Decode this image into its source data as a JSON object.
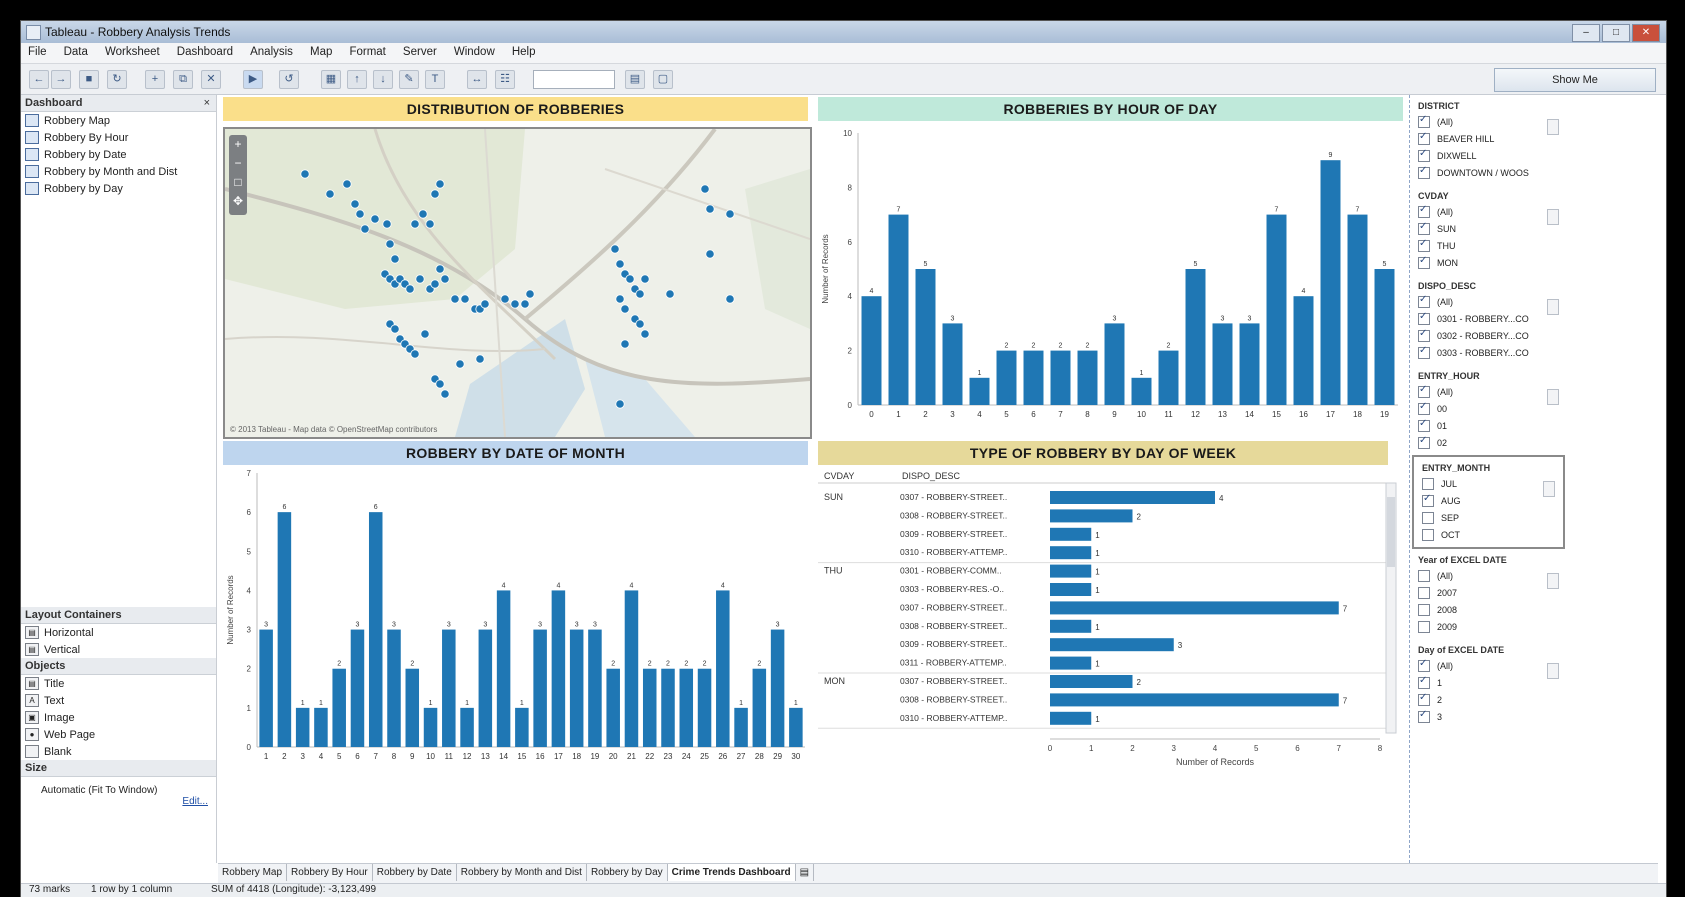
{
  "window": {
    "title": "Tableau - Robbery Analysis Trends",
    "controls": [
      "–",
      "□",
      "✕"
    ]
  },
  "menu": [
    "File",
    "Data",
    "Worksheet",
    "Dashboard",
    "Analysis",
    "Map",
    "Format",
    "Server",
    "Window",
    "Help"
  ],
  "toolbar": {
    "show_me": "Show Me"
  },
  "left_panel": {
    "dashboard_header": "Dashboard",
    "close": "×",
    "sheets": [
      "Robbery Map",
      "Robbery By Hour",
      "Robbery by Date",
      "Robbery by Month and Dist",
      "Robbery by Day"
    ],
    "layout_header": "Layout Containers",
    "layout_items": [
      "Horizontal",
      "Vertical"
    ],
    "objects_header": "Objects",
    "objects": [
      "Title",
      "Text",
      "Image",
      "Web Page",
      "Blank"
    ],
    "size_header": "Size",
    "size_value": "Automatic (Fit To Window)",
    "edit_link": "Edit..."
  },
  "panels": {
    "map_title": "DISTRIBUTION OF ROBBERIES",
    "map_attribution": "© 2013 Tableau - Map data © OpenStreetMap contributors",
    "hour_title": "ROBBERIES BY HOUR OF DAY",
    "date_title": "ROBBERY BY DATE OF MONTH",
    "type_title": "TYPE OF ROBBERY BY DAY OF WEEK"
  },
  "chart_data": [
    {
      "type": "bar",
      "title": "ROBBERIES BY HOUR OF DAY",
      "ylabel": "Number of Records",
      "ylim": [
        0,
        10
      ],
      "yticks": [
        0,
        2,
        4,
        6,
        8,
        10
      ],
      "categories": [
        "0",
        "1",
        "2",
        "3",
        "4",
        "5",
        "6",
        "7",
        "8",
        "9",
        "10",
        "11",
        "12",
        "13",
        "14",
        "15",
        "16",
        "17",
        "18",
        "19"
      ],
      "values": [
        4,
        7,
        5,
        3,
        1,
        2,
        2,
        2,
        2,
        3,
        1,
        2,
        5,
        3,
        3,
        7,
        4,
        9,
        7,
        5
      ]
    },
    {
      "type": "bar",
      "title": "ROBBERY BY DATE OF MONTH",
      "ylabel": "Number of Records",
      "ylim": [
        0,
        7
      ],
      "yticks": [
        0,
        1,
        2,
        3,
        4,
        5,
        6,
        7
      ],
      "categories": [
        "1",
        "2",
        "3",
        "4",
        "5",
        "6",
        "7",
        "8",
        "9",
        "10",
        "11",
        "12",
        "13",
        "14",
        "15",
        "16",
        "17",
        "18",
        "19",
        "20",
        "21",
        "22",
        "23",
        "24",
        "25",
        "26",
        "27",
        "28",
        "29",
        "30"
      ],
      "values": [
        3,
        6,
        1,
        1,
        2,
        3,
        6,
        3,
        2,
        1,
        3,
        1,
        3,
        4,
        1,
        3,
        4,
        3,
        3,
        2,
        4,
        2,
        2,
        2,
        2,
        4,
        1,
        2,
        3,
        1
      ]
    },
    {
      "type": "bar",
      "title": "TYPE OF ROBBERY BY DAY OF WEEK",
      "orientation": "horizontal",
      "columns": [
        "CVDAY",
        "DISPO_DESC"
      ],
      "xlabel": "Number of Records",
      "xlim": [
        0,
        8
      ],
      "xticks": [
        0,
        1,
        2,
        3,
        4,
        5,
        6,
        7,
        8
      ],
      "groups": [
        {
          "day": "SUN",
          "rows": [
            {
              "label": "0307 - ROBBERY-STREET..",
              "value": 4
            },
            {
              "label": "0308 - ROBBERY-STREET..",
              "value": 2
            },
            {
              "label": "0309 - ROBBERY-STREET..",
              "value": 1
            },
            {
              "label": "0310 - ROBBERY-ATTEMP..",
              "value": 1
            }
          ]
        },
        {
          "day": "THU",
          "rows": [
            {
              "label": "0301 - ROBBERY-COMM..",
              "value": 1
            },
            {
              "label": "0303 - ROBBERY-RES.-O..",
              "value": 1
            },
            {
              "label": "0307 - ROBBERY-STREET..",
              "value": 7
            },
            {
              "label": "0308 - ROBBERY-STREET..",
              "value": 1
            },
            {
              "label": "0309 - ROBBERY-STREET..",
              "value": 3
            },
            {
              "label": "0311 - ROBBERY-ATTEMP..",
              "value": 1
            }
          ]
        },
        {
          "day": "MON",
          "rows": [
            {
              "label": "0307 - ROBBERY-STREET..",
              "value": 2
            },
            {
              "label": "0308 - ROBBERY-STREET..",
              "value": 7
            },
            {
              "label": "0310 - ROBBERY-ATTEMP..",
              "value": 1
            }
          ]
        }
      ]
    },
    {
      "type": "scatter",
      "title": "DISTRIBUTION OF ROBBERIES",
      "x": [
        80,
        105,
        122,
        130,
        135,
        140,
        150,
        162,
        165,
        170,
        190,
        198,
        205,
        210,
        215,
        160,
        165,
        170,
        175,
        180,
        185,
        195,
        205,
        210,
        215,
        220,
        230,
        240,
        250,
        255,
        260,
        280,
        290,
        300,
        305,
        165,
        170,
        175,
        180,
        185,
        190,
        200,
        210,
        215,
        220,
        235,
        255,
        390,
        395,
        400,
        405,
        410,
        415,
        420,
        395,
        400,
        480,
        485,
        505,
        485,
        410,
        415,
        420,
        400,
        445,
        395,
        505
      ],
      "y": [
        45,
        65,
        55,
        75,
        85,
        100,
        90,
        95,
        115,
        130,
        95,
        85,
        95,
        65,
        55,
        145,
        150,
        155,
        150,
        155,
        160,
        150,
        160,
        155,
        140,
        150,
        170,
        170,
        180,
        180,
        175,
        170,
        175,
        175,
        165,
        195,
        200,
        210,
        215,
        220,
        225,
        205,
        250,
        255,
        265,
        235,
        230,
        120,
        135,
        145,
        150,
        160,
        165,
        150,
        170,
        180,
        60,
        80,
        85,
        125,
        190,
        195,
        205,
        215,
        165,
        275,
        170
      ]
    }
  ],
  "filters": [
    {
      "name": "DISTRICT",
      "items": [
        {
          "label": "(All)",
          "checked": true
        },
        {
          "label": "BEAVER HILL",
          "checked": true
        },
        {
          "label": "DIXWELL",
          "checked": true
        },
        {
          "label": "DOWNTOWN / WOOS",
          "checked": true
        }
      ]
    },
    {
      "name": "CVDAY",
      "items": [
        {
          "label": "(All)",
          "checked": true
        },
        {
          "label": "SUN",
          "checked": true
        },
        {
          "label": "THU",
          "checked": true
        },
        {
          "label": "MON",
          "checked": true
        }
      ]
    },
    {
      "name": "DISPO_DESC",
      "items": [
        {
          "label": "(All)",
          "checked": true
        },
        {
          "label": "0301 - ROBBERY...CO",
          "checked": true
        },
        {
          "label": "0302 - ROBBERY...CO",
          "checked": true
        },
        {
          "label": "0303 - ROBBERY...CO",
          "checked": true
        }
      ]
    },
    {
      "name": "ENTRY_HOUR",
      "items": [
        {
          "label": "(All)",
          "checked": true
        },
        {
          "label": "00",
          "checked": true
        },
        {
          "label": "01",
          "checked": true
        },
        {
          "label": "02",
          "checked": true
        }
      ]
    },
    {
      "name": "ENTRY_MONTH",
      "items": [
        {
          "label": "JUL",
          "checked": false
        },
        {
          "label": "AUG",
          "checked": true
        },
        {
          "label": "SEP",
          "checked": false
        },
        {
          "label": "OCT",
          "checked": false
        }
      ]
    },
    {
      "name": "Year of EXCEL DATE",
      "items": [
        {
          "label": "(All)",
          "checked": false
        },
        {
          "label": "2007",
          "checked": false
        },
        {
          "label": "2008",
          "checked": false
        },
        {
          "label": "2009",
          "checked": false
        }
      ]
    },
    {
      "name": "Day of EXCEL DATE",
      "items": [
        {
          "label": "(All)",
          "checked": true
        },
        {
          "label": "1",
          "checked": true
        },
        {
          "label": "2",
          "checked": true
        },
        {
          "label": "3",
          "checked": true
        }
      ]
    }
  ],
  "tabs": [
    "Robbery Map",
    "Robbery By Hour",
    "Robbery by Date",
    "Robbery by Month and Dist",
    "Robbery by Day",
    "Crime Trends Dashboard"
  ],
  "active_tab": "Crime Trends Dashboard",
  "status": {
    "marks": "73 marks",
    "rows": "1 row by 1 column",
    "sum": "SUM of 4418 (Longitude): -3,123,499"
  }
}
